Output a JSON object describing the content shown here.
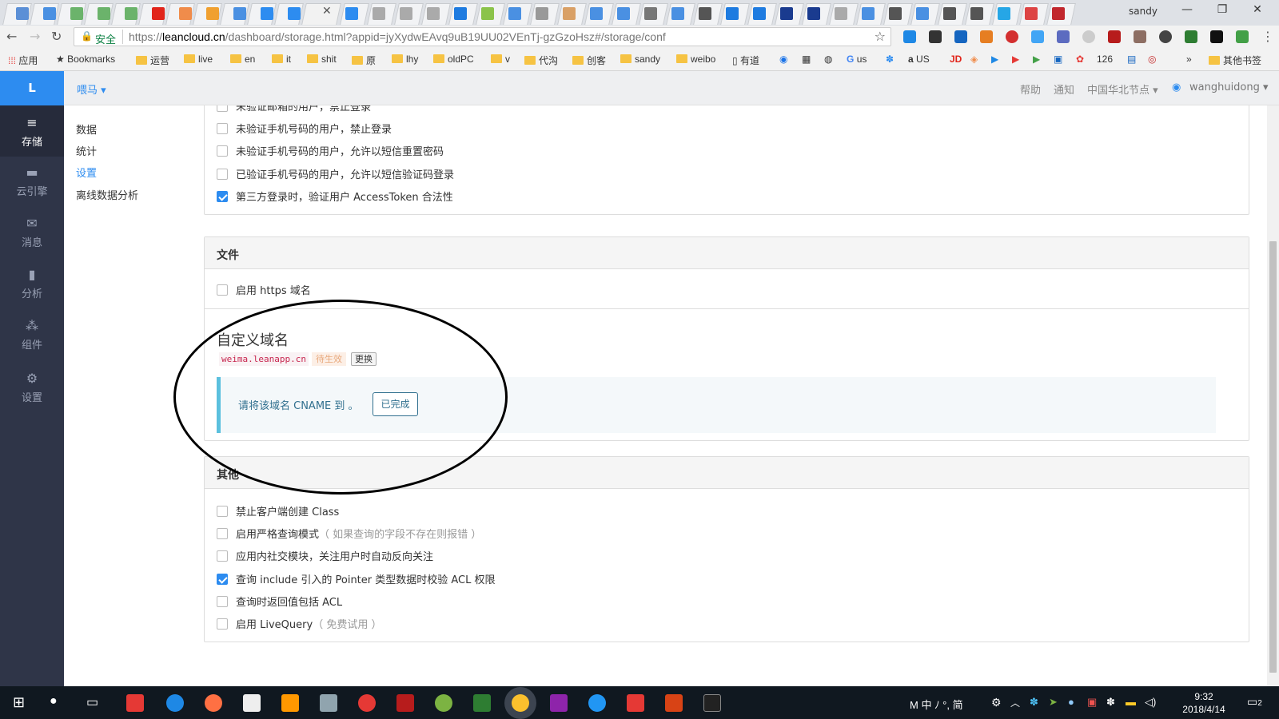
{
  "browser": {
    "user": "sandy",
    "address": {
      "secure_label": "安全",
      "url_scheme": "https://",
      "url_host": "leancloud.cn",
      "url_path": "/dashboard/storage.html?appid=jyXydwEAvq9uB19UU02VEnTj-gzGzoHsz#/storage/conf"
    },
    "bookmarks": [
      "应用",
      "Bookmarks",
      "运营",
      "live",
      "en",
      "it",
      "shit",
      "原",
      "lhy",
      "oldPC",
      "v",
      "代沟",
      "创客",
      "sandy",
      "weibo",
      "有道",
      "us",
      "US",
      "126",
      "其他书签"
    ]
  },
  "app": {
    "logo": "L",
    "name": "喂马 ▾",
    "header_links": {
      "help": "帮助",
      "notice": "通知",
      "region": "中国华北节点 ▾",
      "user": "wanghuidong ▾"
    }
  },
  "sidebar": [
    {
      "label": "存储",
      "icon": "≡"
    },
    {
      "label": "云引擎",
      "icon": "▬"
    },
    {
      "label": "消息",
      "icon": "✉"
    },
    {
      "label": "分析",
      "icon": "▮"
    },
    {
      "label": "组件",
      "icon": "⁂"
    },
    {
      "label": "设置",
      "icon": "⚙"
    }
  ],
  "subnav": [
    "数据",
    "统计",
    "设置",
    "离线数据分析"
  ],
  "user_options": [
    {
      "label": "未验证邮箱的用户，禁止登录",
      "checked": false
    },
    {
      "label": "未验证手机号码的用户，禁止登录",
      "checked": false
    },
    {
      "label": "未验证手机号码的用户，允许以短信重置密码",
      "checked": false
    },
    {
      "label": "已验证手机号码的用户，允许以短信验证码登录",
      "checked": false
    },
    {
      "label": "第三方登录时，验证用户 AccessToken 合法性",
      "checked": true
    }
  ],
  "file_panel": {
    "title": "文件",
    "https_option": "启用 https 域名",
    "custom_domain_title": "自定义域名",
    "domain": "weima.leanapp.cn",
    "status": "待生效",
    "change_label": "更换",
    "cname_text": "请将该域名 CNAME 到 。",
    "done_label": "已完成"
  },
  "other_panel": {
    "title": "其他",
    "options": [
      {
        "label": "禁止客户端创建 Class",
        "hint": "",
        "checked": false
      },
      {
        "label": "启用严格查询模式",
        "hint": "（ 如果查询的字段不存在则报错 ）",
        "checked": false
      },
      {
        "label": "应用内社交模块，关注用户时自动反向关注",
        "hint": "",
        "checked": false
      },
      {
        "label": "查询 include 引入的 Pointer 类型数据时校验 ACL 权限",
        "hint": "",
        "checked": true
      },
      {
        "label": "查询时返回值包括 ACL",
        "hint": "",
        "checked": false
      },
      {
        "label": "启用 LiveQuery",
        "hint": "（ 免费试用 ）",
        "checked": false
      }
    ]
  },
  "taskbar": {
    "ime": "M 中 ﾉ °, 简",
    "time": "9:32",
    "date": "2018/4/14",
    "notif": "2"
  },
  "colors": {
    "accent": "#2d8cf0",
    "sidebar": "#2f3548",
    "check": "#2d8cf0"
  }
}
